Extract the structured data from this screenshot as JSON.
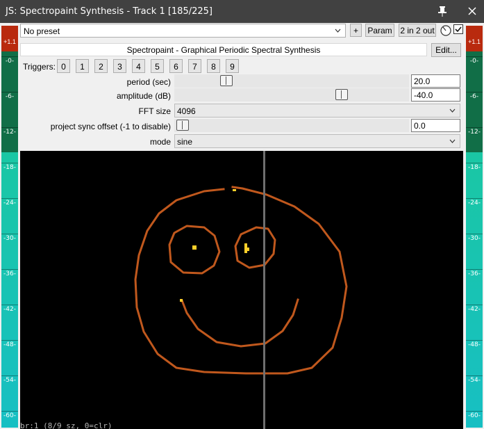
{
  "window": {
    "title": "JS: Spectropaint Synthesis - Track 1 [185/225]"
  },
  "meter": {
    "clip_label": "+1.1",
    "ticks": [
      "-0-",
      "-6-",
      "-12-",
      "-18-",
      "-24-",
      "-30-",
      "-36-",
      "-42-",
      "-48-",
      "-54-",
      "-60-"
    ]
  },
  "toolbar": {
    "preset": "No preset",
    "add_label": "+",
    "param_label": "Param",
    "io_label": "2 in 2 out",
    "bypass_checked": true
  },
  "plugin": {
    "name": "Spectropaint - Graphical Periodic Spectral Synthesis",
    "edit_label": "Edit..."
  },
  "triggers": {
    "label": "Triggers:",
    "buttons": [
      "0",
      "1",
      "2",
      "3",
      "4",
      "5",
      "6",
      "7",
      "8",
      "9"
    ]
  },
  "params": {
    "period": {
      "label": "period (sec)",
      "value": "20.0",
      "slider_fraction": 0.205
    },
    "amplitude": {
      "label": "amplitude (dB)",
      "value": "-40.0",
      "slider_fraction": 0.725
    },
    "fft_size": {
      "label": "FFT size",
      "value": "4096"
    },
    "sync": {
      "label": "project sync offset (-1 to disable)",
      "value": "0.0",
      "slider_fraction": 0.01
    },
    "mode": {
      "label": "mode",
      "value": "sine"
    }
  },
  "canvas": {
    "status_text": "br:1 (8/9 sz, 0=clr)",
    "playhead_fraction": 0.55,
    "colors": {
      "background": "#000000",
      "stroke": "#c0581d",
      "highlight": "#ffd02a",
      "playhead": "#6f6f6f"
    }
  }
}
